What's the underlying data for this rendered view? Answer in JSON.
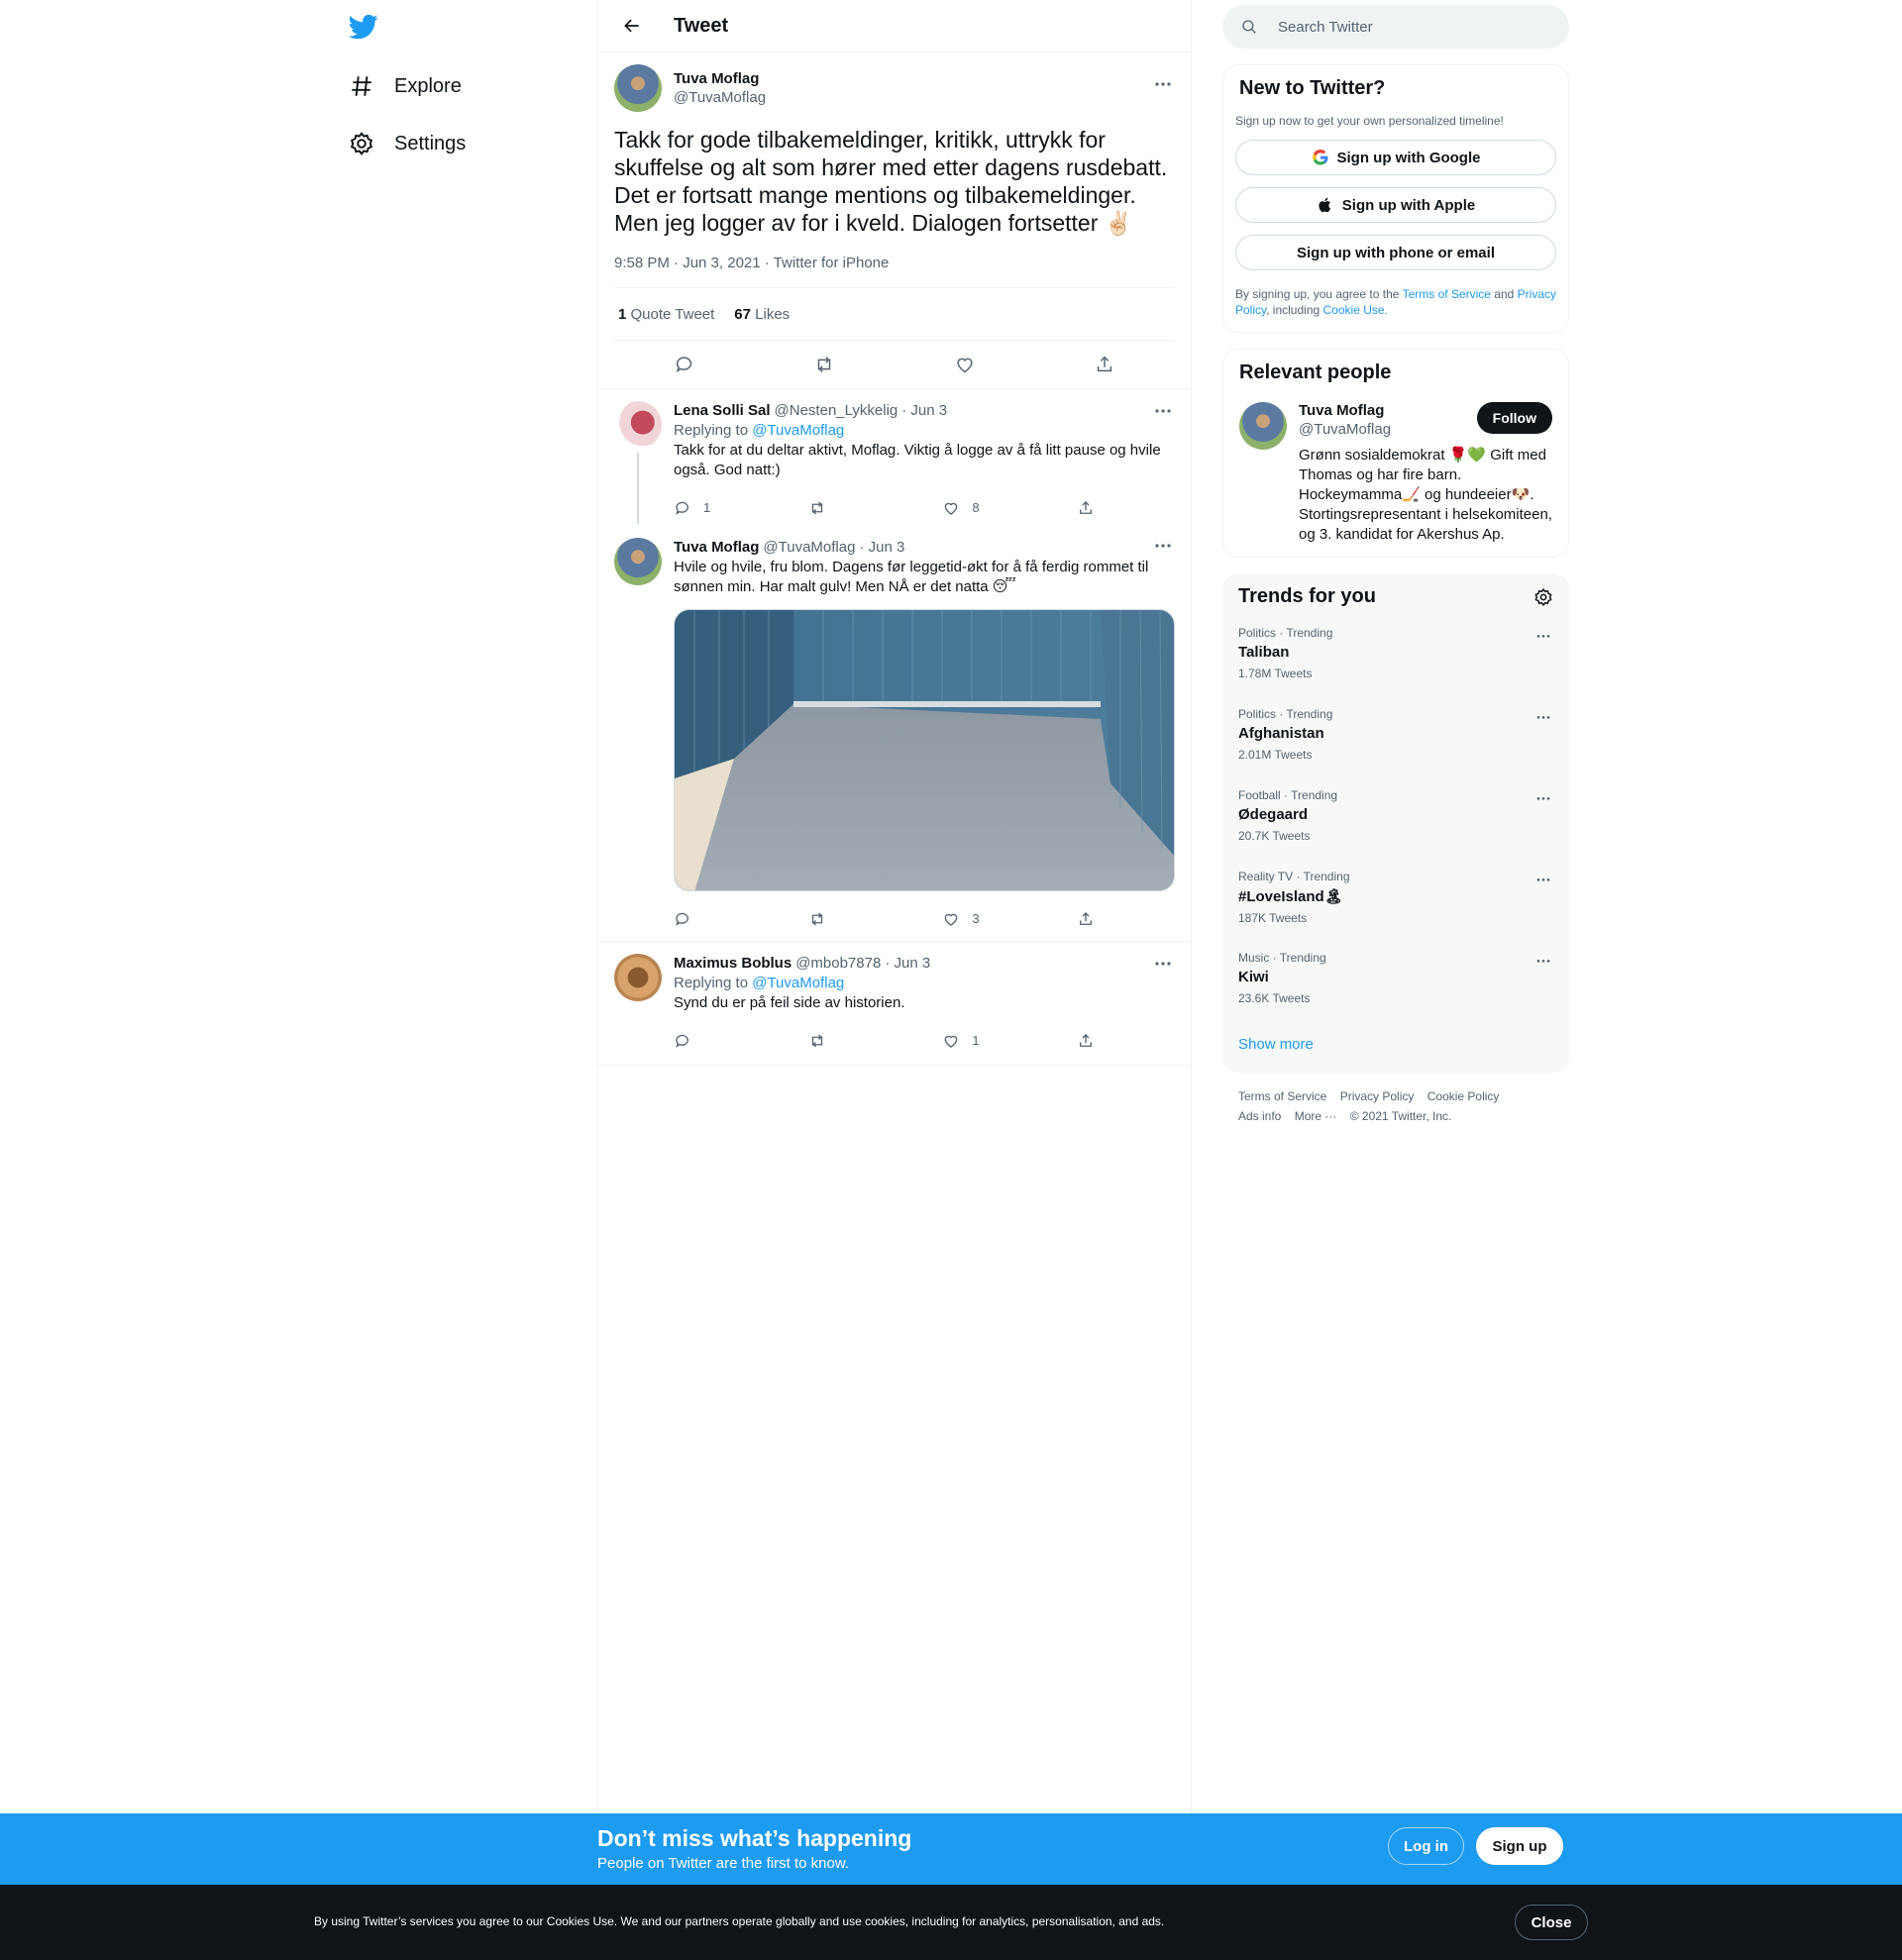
{
  "nav": {
    "explore": "Explore",
    "settings": "Settings"
  },
  "header": {
    "title": "Tweet"
  },
  "focal_tweet": {
    "name": "Tuva Moflag",
    "handle": "@TuvaMoflag",
    "text": "Takk for gode tilbakemeldinger, kritikk, uttrykk for skuffelse og alt som hører med etter dagens rusdebatt. Det er fortsatt mange mentions og tilbakemeldinger. Men jeg logger av for i kveld. Dialogen fortsetter ✌🏻",
    "meta": "9:58 PM · Jun 3, 2021 · Twitter for iPhone",
    "quote_count": "1",
    "quote_label": "Quote Tweet",
    "likes_count": "67",
    "likes_label": "Likes"
  },
  "replies": [
    {
      "name": "Lena Solli Sal",
      "handle": "@Nesten_Lykkelig",
      "date": "· Jun 3",
      "replying_prefix": "Replying to",
      "replying_to": "@TuvaMoflag",
      "text": "Takk for at du deltar aktivt, Moflag. Viktig å logge av å få litt pause og hvile også. God natt:)",
      "reply_count": "1",
      "like_count": "8"
    },
    {
      "name": "Tuva Moflag",
      "handle": "@TuvaMoflag",
      "date": "· Jun 3",
      "text": "Hvile og hvile, fru blom. Dagens før leggetid-økt for å få ferdig rommet til sønnen min. Har malt gulv! Men NÅ er det natta 😴",
      "like_count": "3"
    },
    {
      "name": "Maximus Boblus",
      "handle": "@mbob7878",
      "date": "· Jun 3",
      "replying_prefix": "Replying to",
      "replying_to": "@TuvaMoflag",
      "text": "Synd du er på feil side av historien.",
      "like_count": "1"
    }
  ],
  "search": {
    "placeholder": "Search Twitter"
  },
  "signup_card": {
    "title": "New to Twitter?",
    "subtitle": "Sign up now to get your own personalized timeline!",
    "google": "Sign up with Google",
    "apple": "Sign up with Apple",
    "phone": "Sign up with phone or email",
    "legal_1": "By signing up, you agree to the",
    "terms": "Terms of Service",
    "legal_2": "and",
    "privacy": "Privacy Policy",
    "legal_3": ", including",
    "cookie": "Cookie Use."
  },
  "relevant_people": {
    "title": "Relevant people",
    "name": "Tuva Moflag",
    "handle": "@TuvaMoflag",
    "follow": "Follow",
    "bio": "Grønn sosialdemokrat 🌹💚 Gift med Thomas og har fire barn. Hockeymamma🏒 og hundeeier🐶. Stortingsrepresentant i helsekomiteen, og 3. kandidat for Akershus Ap."
  },
  "trends": {
    "title": "Trends for you",
    "items": [
      {
        "context": "Politics · Trending",
        "name": "Taliban",
        "count": "1.78M Tweets"
      },
      {
        "context": "Politics · Trending",
        "name": "Afghanistan",
        "count": "2.01M Tweets"
      },
      {
        "context": "Football · Trending",
        "name": "Ødegaard",
        "count": "20.7K Tweets"
      },
      {
        "context": "Reality TV · Trending",
        "name": "#LoveIsland🏝",
        "count": "187K Tweets"
      },
      {
        "context": "Music · Trending",
        "name": "Kiwi",
        "count": "23.6K Tweets"
      }
    ],
    "show_more": "Show more"
  },
  "footer": {
    "terms": "Terms of Service",
    "privacy": "Privacy Policy",
    "cookie": "Cookie Policy",
    "ads": "Ads info",
    "more": "More ···",
    "copyright": "© 2021 Twitter, Inc."
  },
  "banner": {
    "title": "Don’t miss what’s happening",
    "subtitle": "People on Twitter are the first to know.",
    "login": "Log in",
    "signup": "Sign up"
  },
  "cookie_bar": {
    "text": "By using Twitter’s services you agree to our Cookies Use. We and our partners operate globally and use cookies, including for analytics, personalisation, and ads.",
    "close": "Close"
  },
  "colors": {
    "accent": "#1d9bf0",
    "text": "#0f1419",
    "muted": "#536471"
  }
}
